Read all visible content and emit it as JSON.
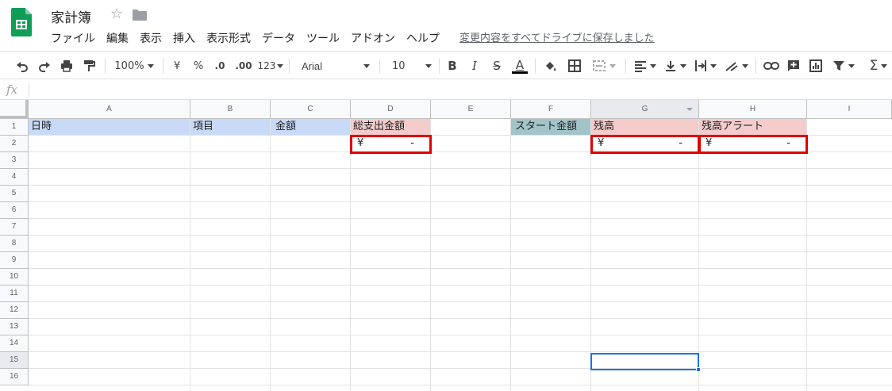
{
  "app": {
    "title": "家計簿",
    "menu": [
      "ファイル",
      "編集",
      "表示",
      "挿入",
      "表示形式",
      "データ",
      "ツール",
      "アドオン",
      "ヘルプ"
    ],
    "save_status": "変更内容をすべてドライブに保存しました",
    "accent_color": "#0f9d58"
  },
  "toolbar": {
    "zoom": "100%",
    "currency": "¥",
    "percent": "%",
    "decrease_decimal": ".0",
    "increase_decimal": ".00",
    "more_formats": "123",
    "font": "Arial",
    "font_size": "10",
    "bold": "B",
    "italic": "I",
    "strike": "S",
    "text_color": "A"
  },
  "formula_bar": {
    "icon": "fx",
    "value": ""
  },
  "grid": {
    "columns": [
      "A",
      "B",
      "C",
      "D",
      "E",
      "F",
      "G",
      "H",
      "I"
    ],
    "rows": [
      "1",
      "2",
      "3",
      "4",
      "5",
      "6",
      "7",
      "8",
      "9",
      "10",
      "11",
      "12",
      "13",
      "14",
      "15",
      "16"
    ],
    "cells": {
      "A1": "日時",
      "B1": "項目",
      "C1": "金額",
      "D1": "総支出金額",
      "F1": "スタート金額",
      "G1": "残高",
      "H1": "残高アラート",
      "D2": {
        "symbol": "¥",
        "value": "-"
      },
      "G2": {
        "symbol": "¥",
        "value": "-"
      },
      "H2": {
        "symbol": "¥",
        "value": "-"
      }
    },
    "selected_cell": "G15"
  }
}
